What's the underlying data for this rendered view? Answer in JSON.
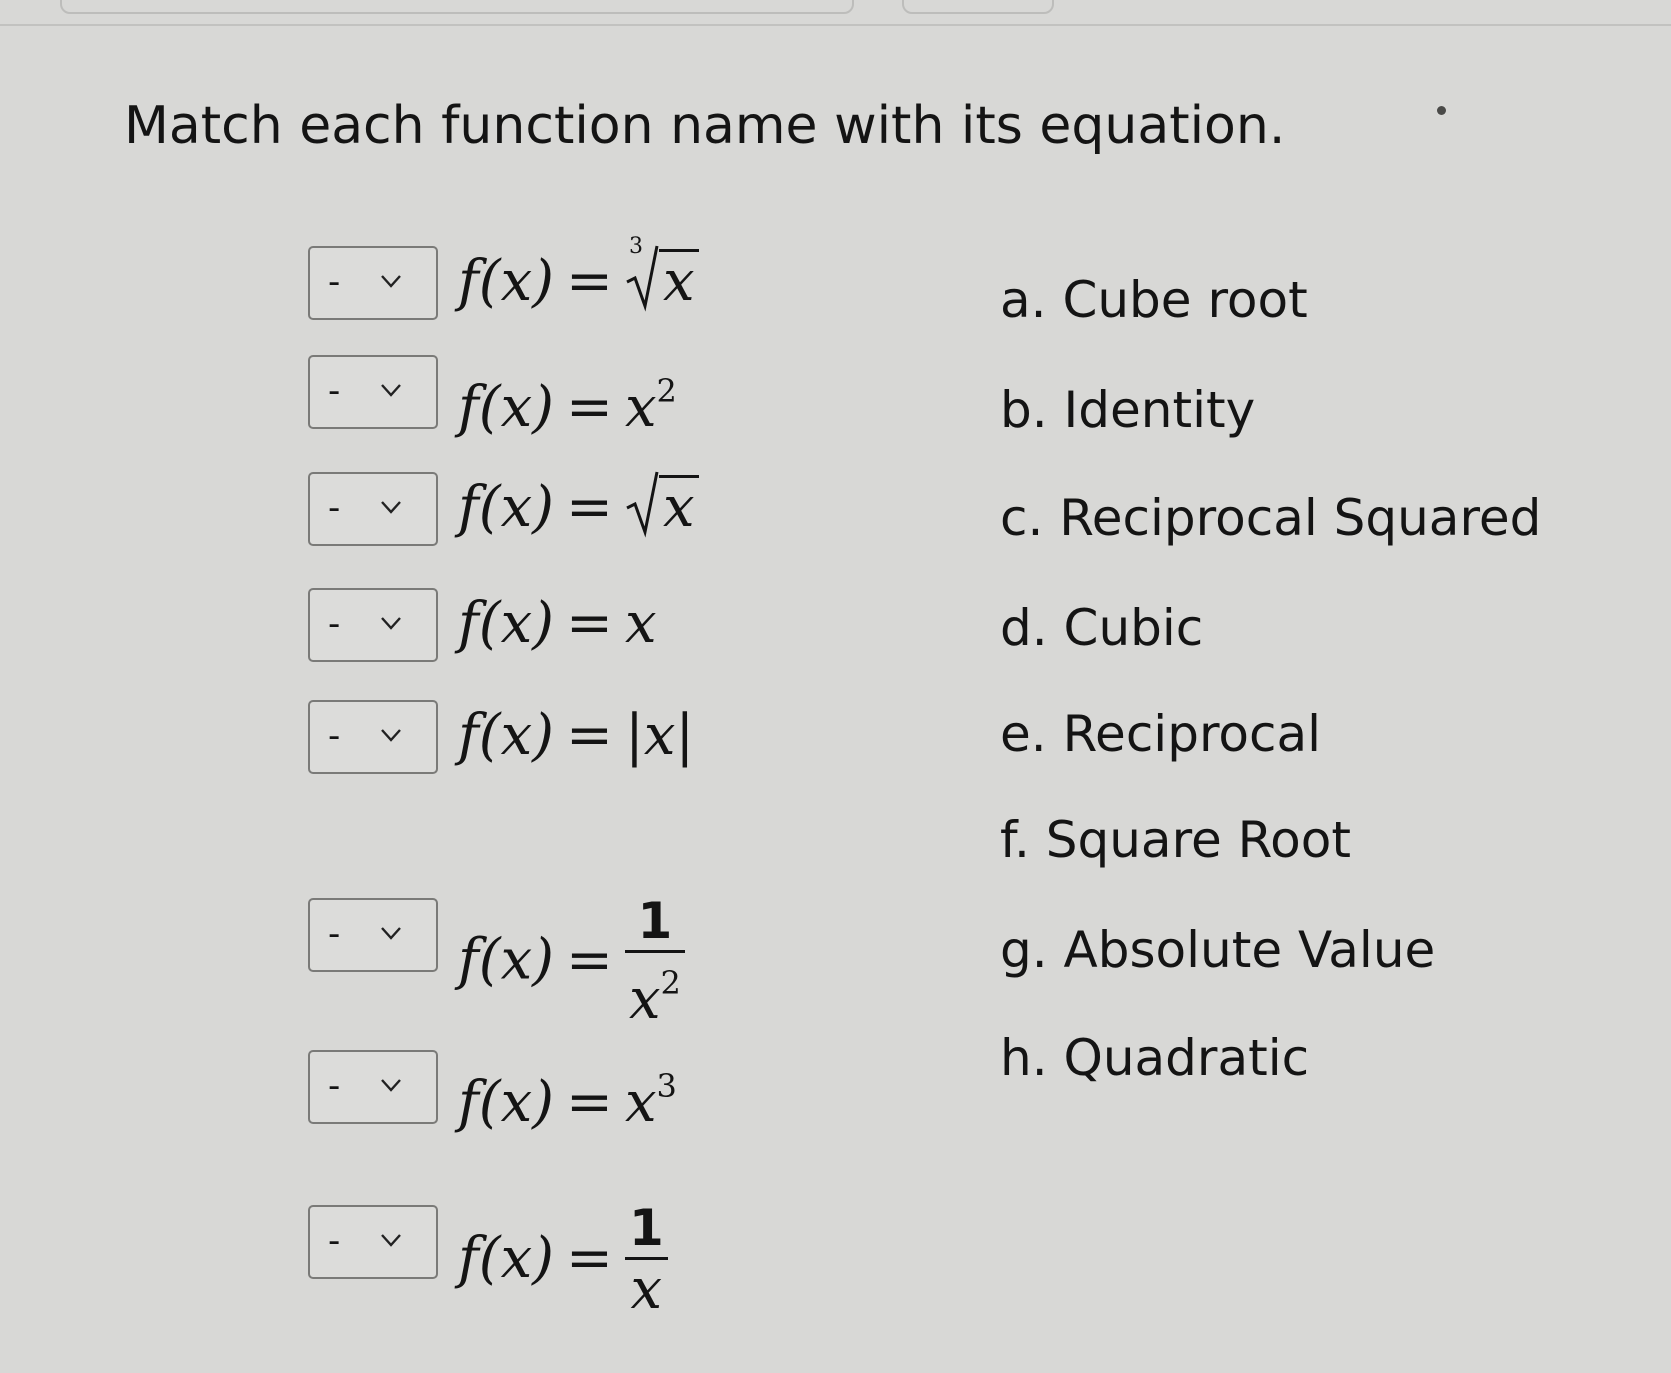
{
  "question": {
    "prompt": "Match each function name with its equation."
  },
  "dropdowns": {
    "selected_value": "-",
    "chevron_icon": "chevron-down-icon"
  },
  "equations": {
    "fx": "f(x)",
    "equals": "=",
    "var": "x",
    "one": "1",
    "cube_index": "3",
    "exp2": "2",
    "exp3": "3",
    "abs_left": "|",
    "abs_right": "|"
  },
  "choices": [
    {
      "letter": "a.",
      "label": "Cube root"
    },
    {
      "letter": "b.",
      "label": "Identity"
    },
    {
      "letter": "c.",
      "label": "Reciprocal Squared"
    },
    {
      "letter": "d.",
      "label": "Cubic"
    },
    {
      "letter": "e.",
      "label": "Reciprocal"
    },
    {
      "letter": "f.",
      "label": "Square Root"
    },
    {
      "letter": "g.",
      "label": "Absolute Value"
    },
    {
      "letter": "h.",
      "label": "Quadratic"
    }
  ]
}
